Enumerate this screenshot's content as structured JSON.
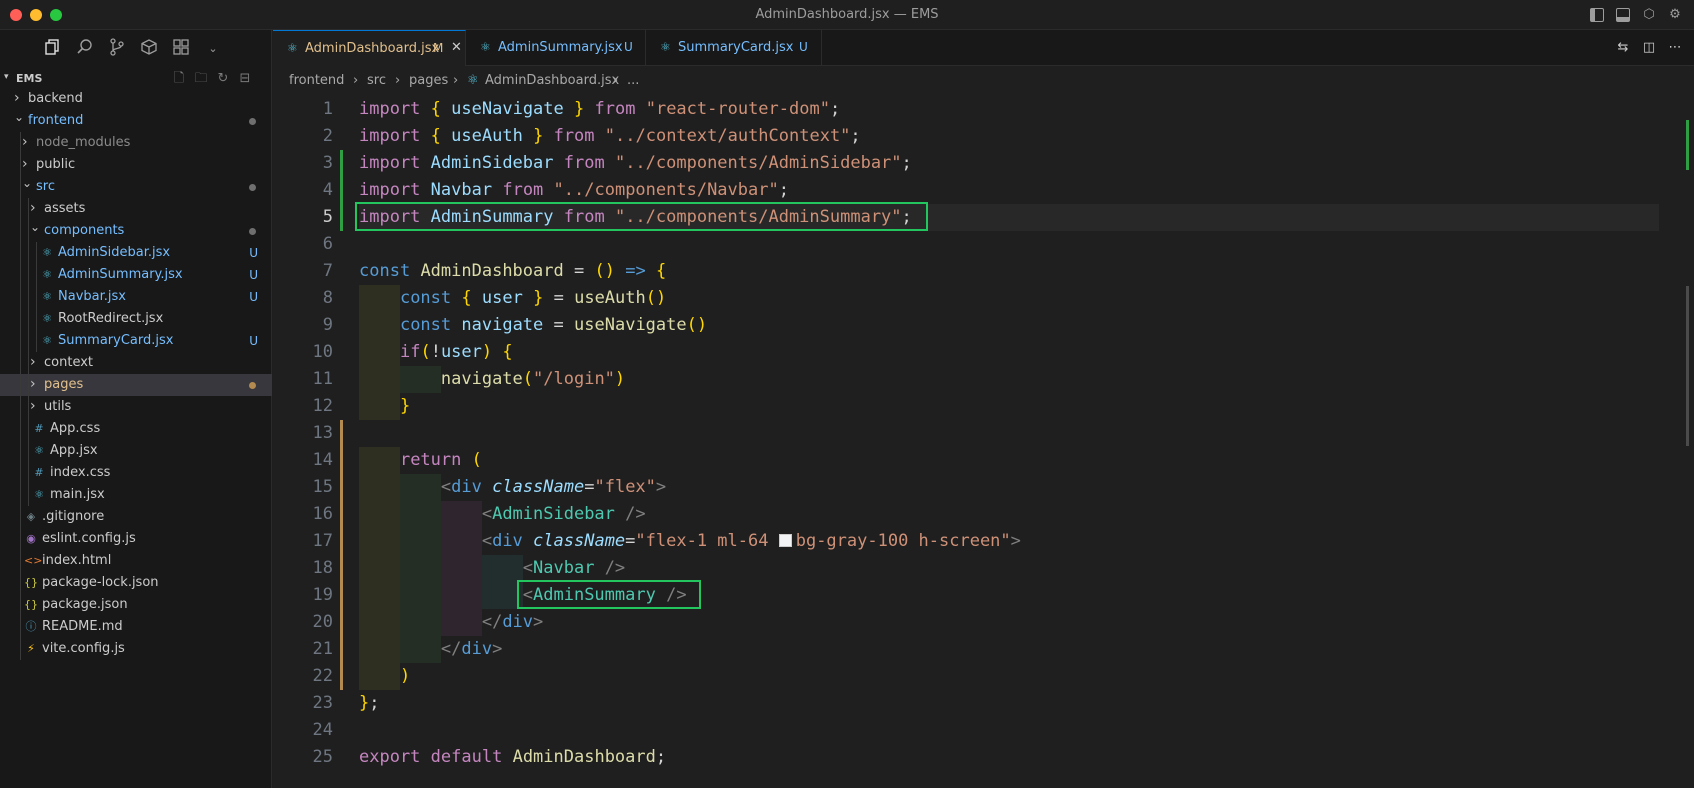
{
  "window": {
    "title": "AdminDashboard.jsx — EMS"
  },
  "explorer": {
    "root_label": "EMS",
    "items": [
      {
        "label": "backend",
        "type": "folder",
        "expanded": false,
        "level": 0,
        "color": "#cccccc",
        "badge": ""
      },
      {
        "label": "frontend",
        "type": "folder",
        "expanded": true,
        "level": 0,
        "color": "#75beff",
        "badge": "dot"
      },
      {
        "label": "node_modules",
        "type": "folder",
        "expanded": false,
        "level": 1,
        "color": "#8b8b8b",
        "badge": ""
      },
      {
        "label": "public",
        "type": "folder",
        "expanded": false,
        "level": 1,
        "color": "#cccccc",
        "badge": ""
      },
      {
        "label": "src",
        "type": "folder",
        "expanded": true,
        "level": 1,
        "color": "#75beff",
        "badge": "dot"
      },
      {
        "label": "assets",
        "type": "folder",
        "expanded": false,
        "level": 2,
        "color": "#cccccc",
        "badge": ""
      },
      {
        "label": "components",
        "type": "folder",
        "expanded": true,
        "level": 2,
        "color": "#75beff",
        "badge": "dot"
      },
      {
        "label": "AdminSidebar.jsx",
        "type": "react",
        "level": 3,
        "color": "#75beff",
        "badge": "U"
      },
      {
        "label": "AdminSummary.jsx",
        "type": "react",
        "level": 3,
        "color": "#75beff",
        "badge": "U"
      },
      {
        "label": "Navbar.jsx",
        "type": "react",
        "level": 3,
        "color": "#75beff",
        "badge": "U"
      },
      {
        "label": "RootRedirect.jsx",
        "type": "react",
        "level": 3,
        "color": "#cccccc",
        "badge": ""
      },
      {
        "label": "SummaryCard.jsx",
        "type": "react",
        "level": 3,
        "color": "#75beff",
        "badge": "U"
      },
      {
        "label": "context",
        "type": "folder",
        "expanded": false,
        "level": 2,
        "color": "#cccccc",
        "badge": ""
      },
      {
        "label": "pages",
        "type": "folder",
        "expanded": false,
        "level": 2,
        "color": "#e2c08d",
        "badge": "dot-orange",
        "selected": true
      },
      {
        "label": "utils",
        "type": "folder",
        "expanded": false,
        "level": 2,
        "color": "#cccccc",
        "badge": ""
      },
      {
        "label": "App.css",
        "type": "css",
        "level": 2,
        "color": "#cccccc",
        "badge": ""
      },
      {
        "label": "App.jsx",
        "type": "react",
        "level": 2,
        "color": "#cccccc",
        "badge": ""
      },
      {
        "label": "index.css",
        "type": "css",
        "level": 2,
        "color": "#cccccc",
        "badge": ""
      },
      {
        "label": "main.jsx",
        "type": "react",
        "level": 2,
        "color": "#cccccc",
        "badge": ""
      },
      {
        "label": ".gitignore",
        "type": "git",
        "level": 1,
        "color": "#cccccc",
        "badge": ""
      },
      {
        "label": "eslint.config.js",
        "type": "eslint",
        "level": 1,
        "color": "#cccccc",
        "badge": ""
      },
      {
        "label": "index.html",
        "type": "html",
        "level": 1,
        "color": "#cccccc",
        "badge": ""
      },
      {
        "label": "package-lock.json",
        "type": "json",
        "level": 1,
        "color": "#cccccc",
        "badge": ""
      },
      {
        "label": "package.json",
        "type": "json",
        "level": 1,
        "color": "#cccccc",
        "badge": ""
      },
      {
        "label": "README.md",
        "type": "info",
        "level": 1,
        "color": "#cccccc",
        "badge": ""
      },
      {
        "label": "vite.config.js",
        "type": "vite",
        "level": 1,
        "color": "#cccccc",
        "badge": ""
      }
    ]
  },
  "tabs": [
    {
      "label": "AdminDashboard.jsx",
      "badge": "M",
      "active": true,
      "color": "#e2c08d"
    },
    {
      "label": "AdminSummary.jsx",
      "badge": "U",
      "active": false,
      "color": "#75beff"
    },
    {
      "label": "SummaryCard.jsx",
      "badge": "U",
      "active": false,
      "color": "#75beff"
    }
  ],
  "breadcrumb": [
    "frontend",
    "src",
    "pages",
    "AdminDashboard.jsx",
    "..."
  ],
  "breadcrumb_separator": "›",
  "editor": {
    "current_line": 5,
    "line_numbers": [
      "1",
      "2",
      "3",
      "4",
      "5",
      "6",
      "7",
      "8",
      "9",
      "10",
      "11",
      "12",
      "13",
      "14",
      "15",
      "16",
      "17",
      "18",
      "19",
      "20",
      "21",
      "22",
      "23",
      "24",
      "25"
    ],
    "lines": [
      "import { useNavigate } from \"react-router-dom\";",
      "import { useAuth } from \"../context/authContext\";",
      "import AdminSidebar from \"../components/AdminSidebar\";",
      "import Navbar from \"../components/Navbar\";",
      "import AdminSummary from \"../components/AdminSummary\";",
      "",
      "const AdminDashboard = () => {",
      "    const { user } = useAuth()",
      "    const navigate = useNavigate()",
      "    if(!user) {",
      "        navigate(\"/login\")",
      "    }",
      "",
      "    return (",
      "        <div className=\"flex\">",
      "            <AdminSidebar />",
      "            <div className=\"flex-1 ml-64 bg-gray-100 h-screen\">",
      "                <Navbar />",
      "                <AdminSummary />",
      "            </div>",
      "        </div>",
      "    )",
      "};",
      "",
      "export default AdminDashboard;"
    ]
  },
  "colors": {
    "highlight_box": "#22c55e",
    "modified": "#e2c08d",
    "untracked": "#75beff",
    "accent": "#0078d4"
  }
}
